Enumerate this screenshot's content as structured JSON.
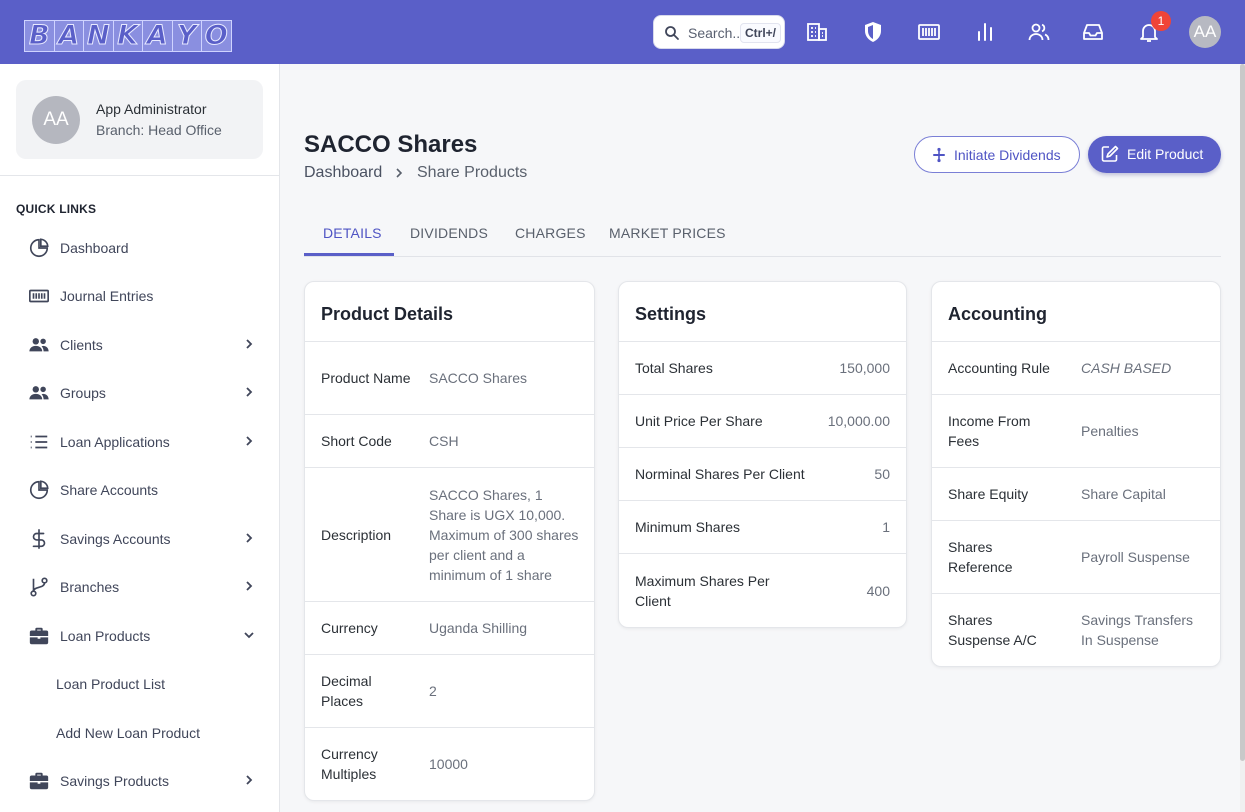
{
  "topbar": {
    "logo_letters": [
      "B",
      "A",
      "N",
      "K",
      "A",
      "Y",
      "O"
    ],
    "search_placeholder": "Search..",
    "search_shortcut": "Ctrl+/",
    "notification_count": "1",
    "avatar_initials": "AA",
    "accent_color": "#5a5fc8",
    "icons": [
      "building-icon",
      "shield-icon",
      "barcode-icon",
      "bar-chart-icon",
      "users-icon",
      "inbox-icon",
      "bell-icon"
    ]
  },
  "sidebar": {
    "user": {
      "initials": "AA",
      "name": "App Administrator",
      "branch": "Branch: Head Office"
    },
    "section_title": "QUICK LINKS",
    "items": [
      {
        "label": "Dashboard",
        "icon": "pie-chart-icon"
      },
      {
        "label": "Journal Entries",
        "icon": "barcode-icon"
      },
      {
        "label": "Clients",
        "icon": "users-icon"
      },
      {
        "label": "Groups",
        "icon": "users-icon"
      },
      {
        "label": "Loan Applications",
        "icon": "list-icon"
      },
      {
        "label": "Share Accounts",
        "icon": "pie-chart-icon"
      },
      {
        "label": "Savings Accounts",
        "icon": "dollar-icon"
      },
      {
        "label": "Branches",
        "icon": "git-branch-icon"
      },
      {
        "label": "Loan Products",
        "icon": "briefcase-icon"
      },
      {
        "label": "Loan Product List"
      },
      {
        "label": "Add New Loan Product"
      },
      {
        "label": "Savings Products",
        "icon": "briefcase-icon"
      }
    ]
  },
  "header": {
    "title": "SACCO Shares",
    "breadcrumb": [
      "Dashboard",
      "Share Products"
    ],
    "initiate_dividends": "Initiate Dividends",
    "edit_product": "Edit Product"
  },
  "tabs": [
    "DETAILS",
    "DIVIDENDS",
    "CHARGES",
    "MARKET PRICES"
  ],
  "product_details": {
    "title": "Product Details",
    "rows": [
      {
        "label": "Product Name",
        "value": "SACCO Shares"
      },
      {
        "label": "Short Code",
        "value": "CSH"
      },
      {
        "label": "Description",
        "value": "SACCO Shares, 1 Share is UGX 10,000. Maximum of 300 shares per client and a minimum of 1 share"
      },
      {
        "label": "Currency",
        "value": "Uganda Shilling"
      },
      {
        "label": "Decimal Places",
        "value": "2"
      },
      {
        "label": "Currency Multiples",
        "value": "10000"
      }
    ]
  },
  "settings": {
    "title": "Settings",
    "rows": [
      {
        "label": "Total Shares",
        "value": "150,000"
      },
      {
        "label": "Unit Price Per Share",
        "value": "10,000.00"
      },
      {
        "label": "Norminal Shares Per Client",
        "value": "50"
      },
      {
        "label": "Minimum Shares",
        "value": "1"
      },
      {
        "label": "Maximum Shares Per Client",
        "value": "400"
      }
    ]
  },
  "accounting": {
    "title": "Accounting",
    "rows": [
      {
        "label": "Accounting Rule",
        "value": "CASH BASED"
      },
      {
        "label": "Income From Fees",
        "value": "Penalties"
      },
      {
        "label": "Share Equity",
        "value": "Share Capital"
      },
      {
        "label": "Shares Reference",
        "value": "Payroll Suspense"
      },
      {
        "label": "Shares Suspense A/C",
        "value": "Savings Transfers In Suspense"
      }
    ]
  }
}
